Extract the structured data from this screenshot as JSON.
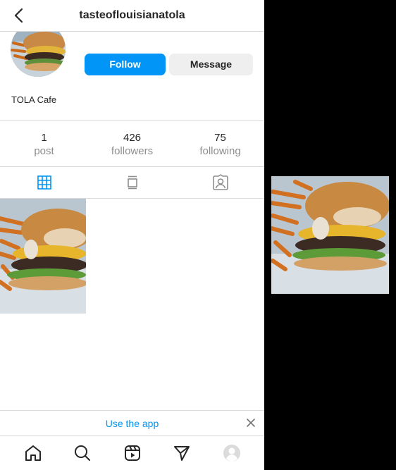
{
  "header": {
    "title": "tasteoflouisianatola",
    "back_icon": "chevron-left-icon"
  },
  "profile": {
    "username": "tasteoflouisianatola",
    "full_name": "TOLA Cafe",
    "follow_label": "Follow",
    "message_label": "Message",
    "accent_color": "#0095f6"
  },
  "stats": [
    {
      "value": "1",
      "label": "post"
    },
    {
      "value": "426",
      "label": "followers"
    },
    {
      "value": "75",
      "label": "following"
    }
  ],
  "tabs": [
    {
      "icon": "grid-icon",
      "active": true
    },
    {
      "icon": "feed-icon",
      "active": false
    },
    {
      "icon": "tagged-icon",
      "active": false
    }
  ],
  "banner": {
    "text": "Use the app",
    "close_icon": "close-icon"
  },
  "bottom_nav": [
    "home-icon",
    "search-icon",
    "reels-icon",
    "direct-icon",
    "profile-icon"
  ]
}
